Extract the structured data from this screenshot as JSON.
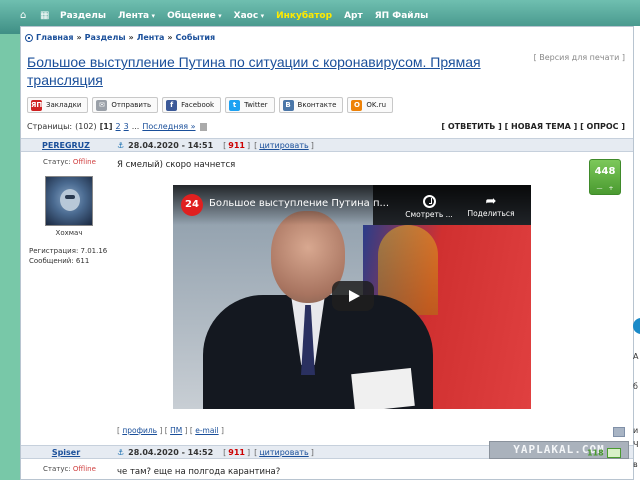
{
  "nav": {
    "items": [
      {
        "label": "Разделы",
        "caret": false,
        "yellow": false
      },
      {
        "label": "Лента",
        "caret": true,
        "yellow": false
      },
      {
        "label": "Общение",
        "caret": true,
        "yellow": false
      },
      {
        "label": "Хаос",
        "caret": true,
        "yellow": false
      },
      {
        "label": "Инкубатор",
        "caret": false,
        "yellow": true
      },
      {
        "label": "Арт",
        "caret": false,
        "yellow": false
      },
      {
        "label": "ЯП Файлы",
        "caret": false,
        "yellow": false
      }
    ]
  },
  "breadcrumb": {
    "items": [
      "Главная",
      "Разделы",
      "Лента",
      "События"
    ],
    "sep": "»"
  },
  "topic": {
    "title": "Большое выступление Путина по ситуации с коронавирусом. Прямая трансляция",
    "print_version": "[ Версия для печати ]"
  },
  "share": [
    {
      "label": "Закладки",
      "icon": "yap-icon",
      "color": "#d02020",
      "glyph": "ЯП"
    },
    {
      "label": "Отправить",
      "icon": "mail-icon",
      "color": "#9aa0a8",
      "glyph": "✉"
    },
    {
      "label": "Facebook",
      "icon": "facebook-icon",
      "color": "#3b5998",
      "glyph": "f"
    },
    {
      "label": "Twitter",
      "icon": "twitter-icon",
      "color": "#1da1f2",
      "glyph": "t"
    },
    {
      "label": "Вконтакте",
      "icon": "vk-icon",
      "color": "#4a76a8",
      "glyph": "В"
    },
    {
      "label": "OK.ru",
      "icon": "ok-icon",
      "color": "#ee8208",
      "glyph": "О"
    }
  ],
  "pagination": {
    "label": "Страницы:",
    "count": "(102)",
    "current": "[1]",
    "pages": [
      "2",
      "3"
    ],
    "ellipsis": "...",
    "last": "Последняя »"
  },
  "actions": "[ ОТВЕТИТЬ ] [ НОВАЯ ТЕМА ] [ ОПРОС ]",
  "posts": [
    {
      "author": "PEREGRUZ",
      "status_label": "Статус:",
      "status": "Offline",
      "avatar_name": "Хохмач",
      "reg": "Регистрация: 7.01.16",
      "msgs": "Сообщений: 611",
      "date": "28.04.2020 - 14:51",
      "num": "911",
      "quote": "цитировать",
      "text": "Я смелый) скоро начнется",
      "rating": "448",
      "links": {
        "profile": "профиль",
        "pm": "ПМ",
        "email": "e-mail"
      }
    },
    {
      "author": "Spiser",
      "status_label": "Статус:",
      "status": "Offline",
      "date": "28.04.2020 - 14:52",
      "num": "911",
      "quote": "цитировать",
      "text": "че там? еще на полгода карантина?",
      "rating": "118"
    }
  ],
  "video": {
    "channel": "24",
    "title": "Большое выступление Путина п...",
    "later": "Смотреть ...",
    "share": "Поделиться"
  },
  "rating_controls": {
    "minus": "—",
    "plus": "+"
  },
  "watermark": "YAPLAKAL.COM",
  "side": {
    "a": "А",
    "b": "б",
    "c": "и",
    "d": "Ч",
    "e": "в"
  }
}
